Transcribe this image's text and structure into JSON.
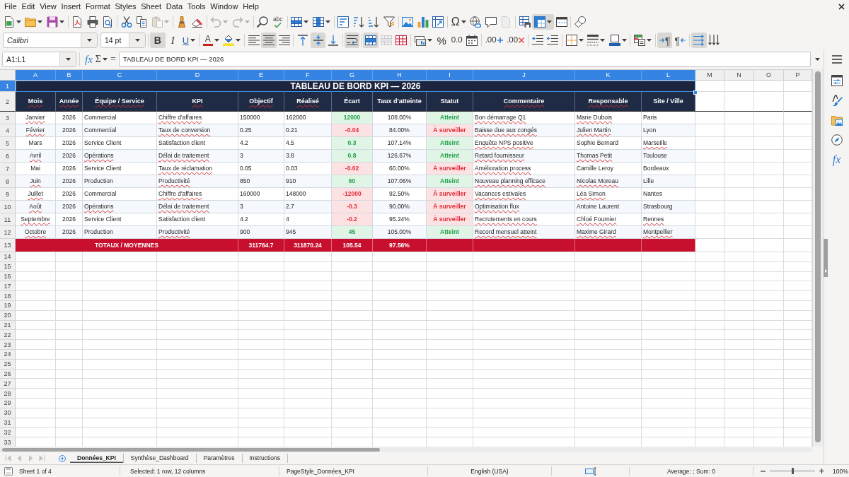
{
  "menu_bar": {
    "items": [
      "File",
      "Edit",
      "View",
      "Insert",
      "Format",
      "Styles",
      "Sheet",
      "Data",
      "Tools",
      "Window",
      "Help"
    ]
  },
  "standard_toolbar": [
    {
      "on": false,
      "disabled": false
    },
    {
      "on": false,
      "disabled": false
    },
    {
      "on": false,
      "disabled": false
    },
    {
      "on": false,
      "disabled": false
    },
    {
      "on": false,
      "disabled": false
    },
    {
      "on": false,
      "disabled": false
    },
    {
      "on": false,
      "disabled": false
    },
    {
      "on": false,
      "disabled": false
    },
    {
      "on": false,
      "disabled": true
    },
    {
      "on": false,
      "disabled": false
    },
    {
      "on": false,
      "disabled": false
    },
    {
      "on": false,
      "disabled": true
    },
    {
      "on": false,
      "disabled": true
    },
    {
      "on": false,
      "disabled": false
    },
    {
      "label": "abc",
      "on": false,
      "disabled": false
    },
    {
      "on": false,
      "disabled": false
    },
    {
      "on": false,
      "disabled": false
    },
    {
      "on": false,
      "disabled": false
    },
    {
      "on": false,
      "disabled": false
    },
    {
      "on": false,
      "disabled": false
    },
    {
      "on": false,
      "disabled": false
    },
    {
      "on": false,
      "disabled": false
    },
    {
      "on": false,
      "disabled": false
    },
    {
      "on": false,
      "disabled": false
    },
    {
      "label": "Ω",
      "on": false,
      "disabled": false
    },
    {
      "on": false,
      "disabled": false
    },
    {
      "on": false,
      "disabled": false
    },
    {
      "on": false,
      "disabled": true
    },
    {
      "on": false,
      "disabled": false
    },
    {
      "on": true,
      "disabled": false
    },
    {
      "on": false,
      "disabled": false
    },
    {
      "on": false,
      "disabled": false
    }
  ],
  "formatting_toolbar": {
    "font_name": "Calibri",
    "font_size": "14 pt",
    "buttons": [
      {
        "label": "B",
        "on": true,
        "disabled": false
      },
      {
        "label": "I",
        "on": false,
        "disabled": false
      },
      {
        "label": "U",
        "on": false,
        "disabled": false
      },
      {
        "label": "A",
        "on": false,
        "disabled": false
      },
      {
        "on": false,
        "disabled": false
      },
      {
        "on": false,
        "disabled": false
      },
      {
        "on": true,
        "disabled": false
      },
      {
        "on": false,
        "disabled": false
      },
      {
        "on": false,
        "disabled": false
      },
      {
        "on": true,
        "disabled": false
      },
      {
        "on": false,
        "disabled": false
      },
      {
        "on": true,
        "disabled": false
      },
      {
        "on": true,
        "disabled": false
      },
      {
        "on": false,
        "disabled": true
      },
      {
        "on": false,
        "disabled": false
      },
      {
        "on": false,
        "disabled": false
      },
      {
        "label": "%",
        "on": false,
        "disabled": false
      },
      {
        "label": "0.0",
        "on": false,
        "disabled": false
      },
      {
        "on": false,
        "disabled": false
      },
      {
        "label": ".00",
        "on": false,
        "disabled": false
      },
      {
        "label": ".00",
        "on": false,
        "disabled": false
      },
      {
        "on": false,
        "disabled": false
      },
      {
        "on": false,
        "disabled": false
      },
      {
        "on": false,
        "disabled": false
      },
      {
        "on": false,
        "disabled": false
      },
      {
        "on": false,
        "disabled": false
      },
      {
        "on": false,
        "disabled": false
      },
      {
        "label": "¶",
        "on": true,
        "disabled": false
      },
      {
        "label": "¶",
        "on": false,
        "disabled": false
      },
      {
        "on": true,
        "disabled": false
      },
      {
        "on": false,
        "disabled": false
      }
    ]
  },
  "formula_bar": {
    "name_box": "A1:L1",
    "function_wizard": "fx",
    "sum": "Σ",
    "formula_sign": "=",
    "formula": "TABLEAU DE BORD KPI — 2026"
  },
  "sheet": {
    "columns": [
      {
        "label": "A",
        "selected": true
      },
      {
        "label": "B",
        "selected": true
      },
      {
        "label": "C",
        "selected": true
      },
      {
        "label": "D",
        "selected": true
      },
      {
        "label": "E",
        "selected": true
      },
      {
        "label": "F",
        "selected": true
      },
      {
        "label": "G",
        "selected": true
      },
      {
        "label": "H",
        "selected": true
      },
      {
        "label": "I",
        "selected": true
      },
      {
        "label": "J",
        "selected": true
      },
      {
        "label": "K",
        "selected": true
      },
      {
        "label": "L",
        "selected": true
      },
      {
        "label": "M",
        "selected": false
      },
      {
        "label": "N",
        "selected": false
      },
      {
        "label": "O",
        "selected": false
      },
      {
        "label": "P",
        "selected": false
      }
    ],
    "rows": [
      {
        "label": "1",
        "selected": true
      },
      {
        "label": "2",
        "selected": false
      },
      {
        "label": "3",
        "selected": false
      },
      {
        "label": "4",
        "selected": false
      },
      {
        "label": "5",
        "selected": false
      },
      {
        "label": "6",
        "selected": false
      },
      {
        "label": "7",
        "selected": false
      },
      {
        "label": "8",
        "selected": false
      },
      {
        "label": "9",
        "selected": false
      },
      {
        "label": "10",
        "selected": false
      },
      {
        "label": "11",
        "selected": false
      },
      {
        "label": "12",
        "selected": false
      },
      {
        "label": "13",
        "selected": false
      },
      {
        "label": "14",
        "selected": false
      },
      {
        "label": "15",
        "selected": false
      },
      {
        "label": "16",
        "selected": false
      },
      {
        "label": "17",
        "selected": false
      },
      {
        "label": "18",
        "selected": false
      },
      {
        "label": "19",
        "selected": false
      },
      {
        "label": "20",
        "selected": false
      },
      {
        "label": "21",
        "selected": false
      },
      {
        "label": "22",
        "selected": false
      },
      {
        "label": "23",
        "selected": false
      },
      {
        "label": "24",
        "selected": false
      },
      {
        "label": "25",
        "selected": false
      },
      {
        "label": "26",
        "selected": false
      },
      {
        "label": "27",
        "selected": false
      },
      {
        "label": "28",
        "selected": false
      },
      {
        "label": "29",
        "selected": false
      },
      {
        "label": "30",
        "selected": false
      },
      {
        "label": "31",
        "selected": false
      },
      {
        "label": "32",
        "selected": false
      },
      {
        "label": "33",
        "selected": false
      }
    ],
    "title": "TABLEAU DE BORD KPI — 2026",
    "headers": [
      {
        "text": "Mois",
        "flagged": true
      },
      {
        "text": "Année",
        "flagged": true
      },
      {
        "text": "Équipe / Service",
        "flagged": true
      },
      {
        "text": "KPI",
        "flagged": true
      },
      {
        "text": "Objectif",
        "flagged": true
      },
      {
        "text": "Réalisé",
        "flagged": true
      },
      {
        "text": "Écart",
        "flagged": false
      },
      {
        "text": "Taux d'atteinte",
        "flagged": false
      },
      {
        "text": "Statut",
        "flagged": false
      },
      {
        "text": "Commentaire",
        "flagged": true
      },
      {
        "text": "Responsable",
        "flagged": true
      },
      {
        "text": "Site / Ville",
        "flagged": false
      }
    ],
    "data_rows": [
      {
        "met": true,
        "cells": [
          {
            "text": "Janvier",
            "flagged": true
          },
          {
            "text": "2026",
            "flagged": false
          },
          {
            "text": "Commercial",
            "flagged": false
          },
          {
            "text": "Chiffre d'affaires",
            "flagged": true
          },
          {
            "text": "150000",
            "flagged": false
          },
          {
            "text": "162000",
            "flagged": false
          },
          {
            "text": "12000",
            "flagged": false
          },
          {
            "text": "108.00%",
            "flagged": false
          },
          {
            "text": "Atteint",
            "flagged": false
          },
          {
            "text": "Bon démarrage Q1",
            "flagged": true
          },
          {
            "text": "Marie Dubois",
            "flagged": true
          },
          {
            "text": "Paris",
            "flagged": false
          }
        ]
      },
      {
        "met": false,
        "cells": [
          {
            "text": "Février",
            "flagged": true
          },
          {
            "text": "2026",
            "flagged": false
          },
          {
            "text": "Commercial",
            "flagged": false
          },
          {
            "text": "Taux de conversion",
            "flagged": true
          },
          {
            "text": "0.25",
            "flagged": false
          },
          {
            "text": "0.21",
            "flagged": false
          },
          {
            "text": "-0.04",
            "flagged": false
          },
          {
            "text": "84.00%",
            "flagged": false
          },
          {
            "text": "À surveiller",
            "flagged": false
          },
          {
            "text": "Baisse due aux congés",
            "flagged": true
          },
          {
            "text": "Julien Martin",
            "flagged": true
          },
          {
            "text": "Lyon",
            "flagged": false
          }
        ]
      },
      {
        "met": true,
        "cells": [
          {
            "text": "Mars",
            "flagged": false
          },
          {
            "text": "2026",
            "flagged": false
          },
          {
            "text": "Service Client",
            "flagged": false
          },
          {
            "text": "Satisfaction client",
            "flagged": false
          },
          {
            "text": "4.2",
            "flagged": false
          },
          {
            "text": "4.5",
            "flagged": false
          },
          {
            "text": "0.3",
            "flagged": false
          },
          {
            "text": "107.14%",
            "flagged": false
          },
          {
            "text": "Atteint",
            "flagged": false
          },
          {
            "text": "Enquête NPS positive",
            "flagged": true
          },
          {
            "text": "Sophie Bernard",
            "flagged": false
          },
          {
            "text": "Marseille",
            "flagged": true
          }
        ]
      },
      {
        "met": true,
        "cells": [
          {
            "text": "Avril",
            "flagged": true
          },
          {
            "text": "2026",
            "flagged": false
          },
          {
            "text": "Opérations",
            "flagged": true
          },
          {
            "text": "Délai de traitement",
            "flagged": true
          },
          {
            "text": "3",
            "flagged": false
          },
          {
            "text": "3.8",
            "flagged": false
          },
          {
            "text": "0.8",
            "flagged": false
          },
          {
            "text": "126.67%",
            "flagged": false
          },
          {
            "text": "Atteint",
            "flagged": false
          },
          {
            "text": "Retard fournisseur",
            "flagged": true
          },
          {
            "text": "Thomas Petit",
            "flagged": true
          },
          {
            "text": "Toulouse",
            "flagged": false
          }
        ]
      },
      {
        "met": false,
        "cells": [
          {
            "text": "Mai",
            "flagged": false
          },
          {
            "text": "2026",
            "flagged": false
          },
          {
            "text": "Service Client",
            "flagged": false
          },
          {
            "text": "Taux de réclamation",
            "flagged": true
          },
          {
            "text": "0.05",
            "flagged": false
          },
          {
            "text": "0.03",
            "flagged": false
          },
          {
            "text": "-0.02",
            "flagged": false
          },
          {
            "text": "60.00%",
            "flagged": false
          },
          {
            "text": "À surveiller",
            "flagged": false
          },
          {
            "text": "Amélioration process",
            "flagged": true
          },
          {
            "text": "Camille Leroy",
            "flagged": false
          },
          {
            "text": "Bordeaux",
            "flagged": false
          }
        ]
      },
      {
        "met": true,
        "cells": [
          {
            "text": "Juin",
            "flagged": true
          },
          {
            "text": "2026",
            "flagged": false
          },
          {
            "text": "Production",
            "flagged": false
          },
          {
            "text": "Productivité",
            "flagged": true
          },
          {
            "text": "850",
            "flagged": false
          },
          {
            "text": "910",
            "flagged": false
          },
          {
            "text": "60",
            "flagged": false
          },
          {
            "text": "107.06%",
            "flagged": false
          },
          {
            "text": "Atteint",
            "flagged": false
          },
          {
            "text": "Nouveau planning efficace",
            "flagged": true
          },
          {
            "text": "Nicolas Moreau",
            "flagged": true
          },
          {
            "text": "Lille",
            "flagged": false
          }
        ]
      },
      {
        "met": false,
        "cells": [
          {
            "text": "Juillet",
            "flagged": true
          },
          {
            "text": "2026",
            "flagged": false
          },
          {
            "text": "Commercial",
            "flagged": false
          },
          {
            "text": "Chiffre d'affaires",
            "flagged": true
          },
          {
            "text": "160000",
            "flagged": false
          },
          {
            "text": "148000",
            "flagged": false
          },
          {
            "text": "-12000",
            "flagged": false
          },
          {
            "text": "92.50%",
            "flagged": false
          },
          {
            "text": "À surveiller",
            "flagged": false
          },
          {
            "text": "Vacances estivales",
            "flagged": true
          },
          {
            "text": "Léa Simon",
            "flagged": true
          },
          {
            "text": "Nantes",
            "flagged": false
          }
        ]
      },
      {
        "met": false,
        "cells": [
          {
            "text": "Août",
            "flagged": true
          },
          {
            "text": "2026",
            "flagged": false
          },
          {
            "text": "Opérations",
            "flagged": true
          },
          {
            "text": "Délai de traitement",
            "flagged": true
          },
          {
            "text": "3",
            "flagged": false
          },
          {
            "text": "2.7",
            "flagged": false
          },
          {
            "text": "-0.3",
            "flagged": false
          },
          {
            "text": "90.00%",
            "flagged": false
          },
          {
            "text": "À surveiller",
            "flagged": false
          },
          {
            "text": "Optimisation flux",
            "flagged": true
          },
          {
            "text": "Antoine Laurent",
            "flagged": false
          },
          {
            "text": "Strasbourg",
            "flagged": false
          }
        ]
      },
      {
        "met": false,
        "cells": [
          {
            "text": "Septembre",
            "flagged": true
          },
          {
            "text": "2026",
            "flagged": false
          },
          {
            "text": "Service Client",
            "flagged": false
          },
          {
            "text": "Satisfaction client",
            "flagged": false
          },
          {
            "text": "4.2",
            "flagged": false
          },
          {
            "text": "4",
            "flagged": false
          },
          {
            "text": "-0.2",
            "flagged": false
          },
          {
            "text": "95.24%",
            "flagged": false
          },
          {
            "text": "À surveiller",
            "flagged": false
          },
          {
            "text": "Recrutements en cours",
            "flagged": true
          },
          {
            "text": "Chloé Fournier",
            "flagged": true
          },
          {
            "text": "Rennes",
            "flagged": true
          }
        ]
      },
      {
        "met": true,
        "cells": [
          {
            "text": "Octobre",
            "flagged": true
          },
          {
            "text": "2026",
            "flagged": false
          },
          {
            "text": "Production",
            "flagged": false
          },
          {
            "text": "Productivité",
            "flagged": true
          },
          {
            "text": "900",
            "flagged": false
          },
          {
            "text": "945",
            "flagged": false
          },
          {
            "text": "45",
            "flagged": false
          },
          {
            "text": "105.00%",
            "flagged": false
          },
          {
            "text": "Atteint",
            "flagged": false
          },
          {
            "text": "Record mensuel atteint",
            "flagged": true
          },
          {
            "text": "Maxime Girard",
            "flagged": true
          },
          {
            "text": "Montpellier",
            "flagged": true
          }
        ]
      }
    ],
    "totals": {
      "label": "TOTAUX / MOYENNES",
      "values": [
        "311764.7",
        "311870.24",
        "105.54",
        "97.56%"
      ]
    }
  },
  "sidebar": {
    "functions_tab": "fx"
  },
  "sheet_tab_navigation": [
    {
      "disabled": true
    },
    {
      "disabled": true
    },
    {
      "disabled": true
    },
    {
      "disabled": true
    }
  ],
  "sheet_tabs": [
    {
      "label": "Données_KPI",
      "selected": true
    },
    {
      "label": "Synthèse_Dashboard",
      "selected": false
    },
    {
      "label": "Paramètres",
      "selected": false
    },
    {
      "label": "Instructions",
      "selected": false
    }
  ],
  "status_bar": {
    "sheet_position": "Sheet 1 of 4",
    "selection": "Selected: 1 row, 12 columns",
    "page_style": "PageStyle_Données_KPI",
    "language": "English (USA)",
    "summary": "Average: ; Sum: 0",
    "zoom": {
      "level": 0.5,
      "reading": "100%"
    }
  }
}
